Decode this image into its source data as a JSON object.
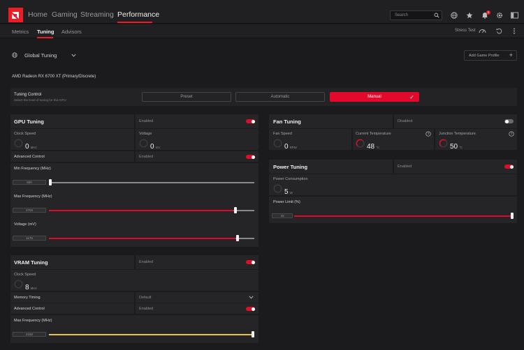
{
  "nav": {
    "home": "Home",
    "gaming": "Gaming",
    "streaming": "Streaming",
    "performance": "Performance",
    "search_placeholder": "Search",
    "notification_count": "1"
  },
  "subnav": {
    "metrics": "Metrics",
    "tuning": "Tuning",
    "advisors": "Advisors",
    "stress_test": "Stress Test"
  },
  "profile": {
    "selected": "Global Tuning",
    "add_label": "Add Game Profile"
  },
  "device_name": "AMD Radeon RX 6700 XT (Primary/Discrete)",
  "tuning_control": {
    "title": "Tuning Control",
    "subtitle": "Select the level of tuning for this GPU",
    "options": [
      "Preset",
      "Automatic",
      "Manual"
    ],
    "selected": "Manual"
  },
  "gpu": {
    "title": "GPU Tuning",
    "state": "Enabled",
    "enabled": true,
    "clock_label": "Clock Speed",
    "clock_value": "0",
    "clock_unit": "MHz",
    "voltage_label": "Voltage",
    "voltage_value": "0",
    "voltage_unit": "mV",
    "advanced_label": "Advanced Control",
    "advanced_state": "Enabled",
    "advanced_enabled": true,
    "min_freq_label": "Min Frequency (MHz)",
    "min_freq_value": "500",
    "min_freq_fraction": 0.0,
    "max_freq_label": "Max Frequency (MHz)",
    "max_freq_value": "2703",
    "max_freq_fraction": 0.9,
    "voltage_slider_label": "Voltage (mV)",
    "voltage_slider_value": "1175",
    "voltage_slider_fraction": 0.91
  },
  "vram": {
    "title": "VRAM Tuning",
    "state": "Enabled",
    "enabled": true,
    "clock_label": "Clock Speed",
    "clock_value": "8",
    "clock_unit": "MHz",
    "memory_timing_label": "Memory Timing",
    "memory_timing_value": "Default",
    "advanced_label": "Advanced Control",
    "advanced_state": "Enabled",
    "advanced_enabled": true,
    "max_freq_label": "Max Frequency (MHz)",
    "max_freq_value": "2150",
    "max_freq_fraction": 1.0
  },
  "fan": {
    "title": "Fan Tuning",
    "state": "Disabled",
    "enabled": false,
    "speed_label": "Fan Speed",
    "speed_value": "0",
    "speed_unit": "RPM",
    "temp_label": "Current Temperature",
    "temp_value": "48",
    "temp_unit": "°C",
    "junction_label": "Junction Temperature",
    "junction_value": "50",
    "junction_unit": "°C"
  },
  "power": {
    "title": "Power Tuning",
    "state": "Enabled",
    "enabled": true,
    "consumption_label": "Power Consumption",
    "consumption_value": "5",
    "consumption_unit": "W",
    "limit_label": "Power Limit (%)",
    "limit_value": "15",
    "limit_fraction": 1.0
  },
  "colors": {
    "accent": "#e3092a",
    "vram_slider": "#e8c34a"
  }
}
